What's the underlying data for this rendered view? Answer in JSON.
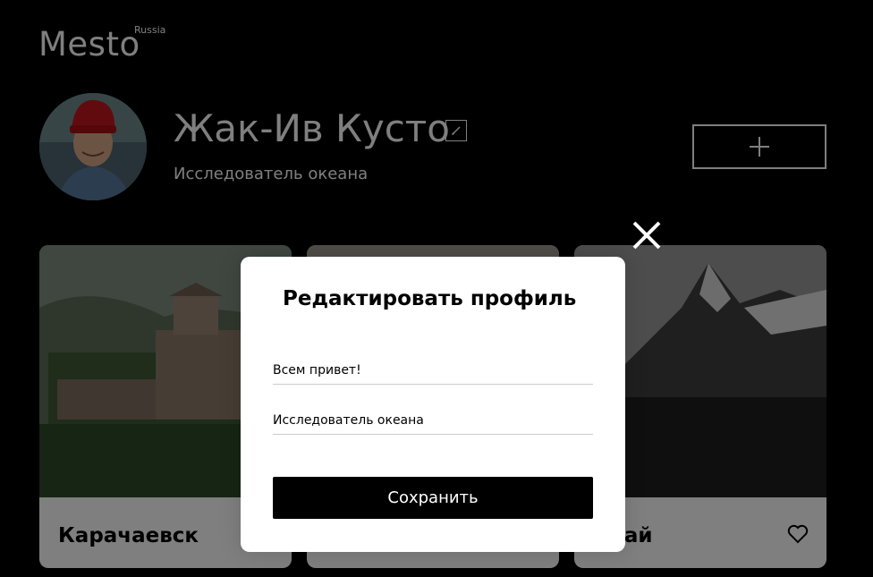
{
  "header": {
    "logo": "Mesto",
    "logo_suffix": "Russia"
  },
  "profile": {
    "name": "Жак-Ив Кусто",
    "about": "Исследователь океана",
    "edit_icon": "pencil-icon",
    "add_icon": "plus-icon"
  },
  "cards": [
    {
      "title": "Карачаевск",
      "like_icon": "heart-icon"
    },
    {
      "title": "",
      "like_icon": "heart-icon"
    },
    {
      "title": "мбай",
      "like_icon": "heart-icon"
    }
  ],
  "popup": {
    "title": "Редактировать профиль",
    "name_value": "Всем привет!",
    "about_value": "Исследователь океана",
    "save_label": "Сохранить",
    "close_icon": "close-icon"
  },
  "colors": {
    "background": "#000000",
    "overlay": "rgba(0,0,0,0.5)",
    "popup": "#ffffff",
    "button": "#000000"
  }
}
